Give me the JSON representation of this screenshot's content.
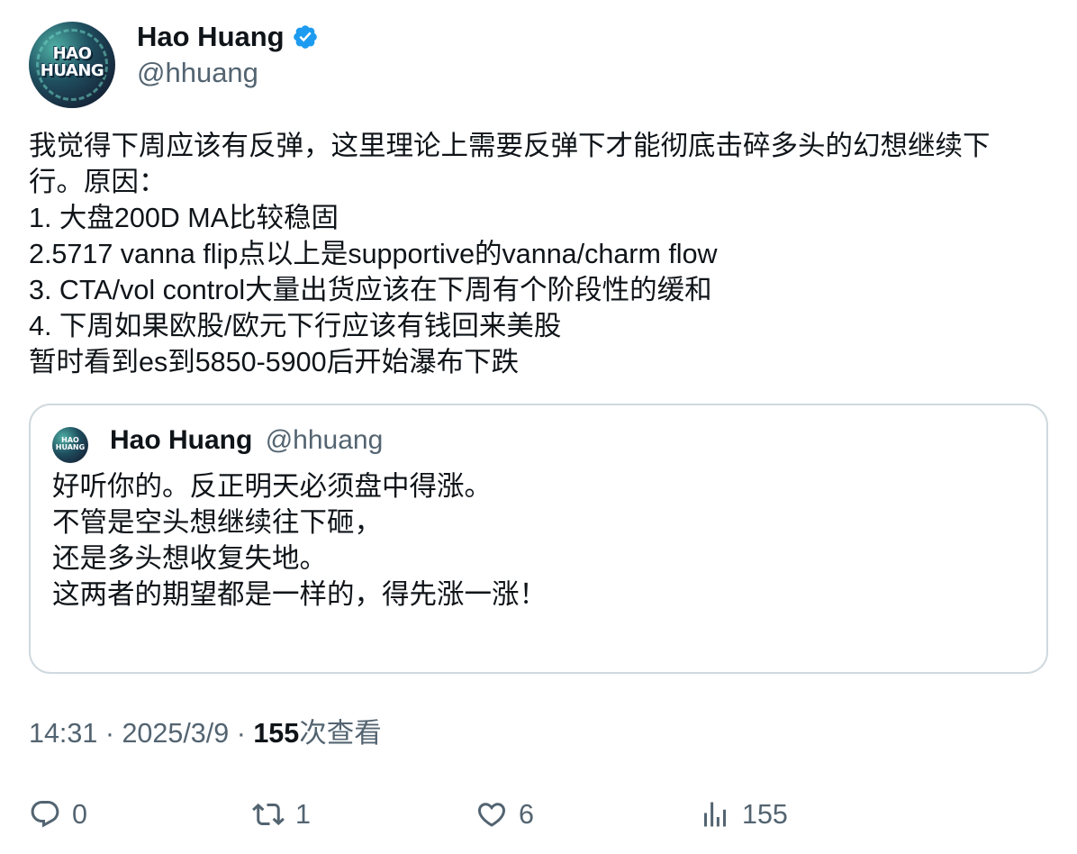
{
  "author": {
    "name": "Hao Huang",
    "handle": "@hhuang",
    "avatar_text_line1": "HAO",
    "avatar_text_line2": "HUANG",
    "verified_icon": "verified-badge-icon"
  },
  "tweet": {
    "lines": [
      "我觉得下周应该有反弹，这里理论上需要反弹下才能彻底击碎多头的幻想继续下",
      "行。原因：",
      "1. 大盘200D MA比较稳固",
      "2.5717 vanna flip点以上是supportive的vanna/charm flow",
      "3. CTA/vol control大量出货应该在下周有个阶段性的缓和",
      "4. 下周如果欧股/欧元下行应该有钱回来美股",
      "暂时看到es到5850-5900后开始瀑布下跌"
    ]
  },
  "quote": {
    "name": "Hao Huang",
    "handle": "@hhuang",
    "lines": [
      "好听你的。反正明天必须盘中得涨。",
      "不管是空头想继续往下砸，",
      "还是多头想收复失地。",
      "这两者的期望都是一样的，得先涨一涨！"
    ]
  },
  "meta": {
    "time": "14:31",
    "separator": "·",
    "date": "2025/3/9",
    "views_count": "155",
    "views_label": "次查看"
  },
  "actions": {
    "replies": "0",
    "retweets": "1",
    "likes": "6",
    "views": "155"
  },
  "colors": {
    "text": "#0f1419",
    "secondary": "#536471",
    "border": "#cfd9de",
    "verified": "#1d9bf0"
  }
}
